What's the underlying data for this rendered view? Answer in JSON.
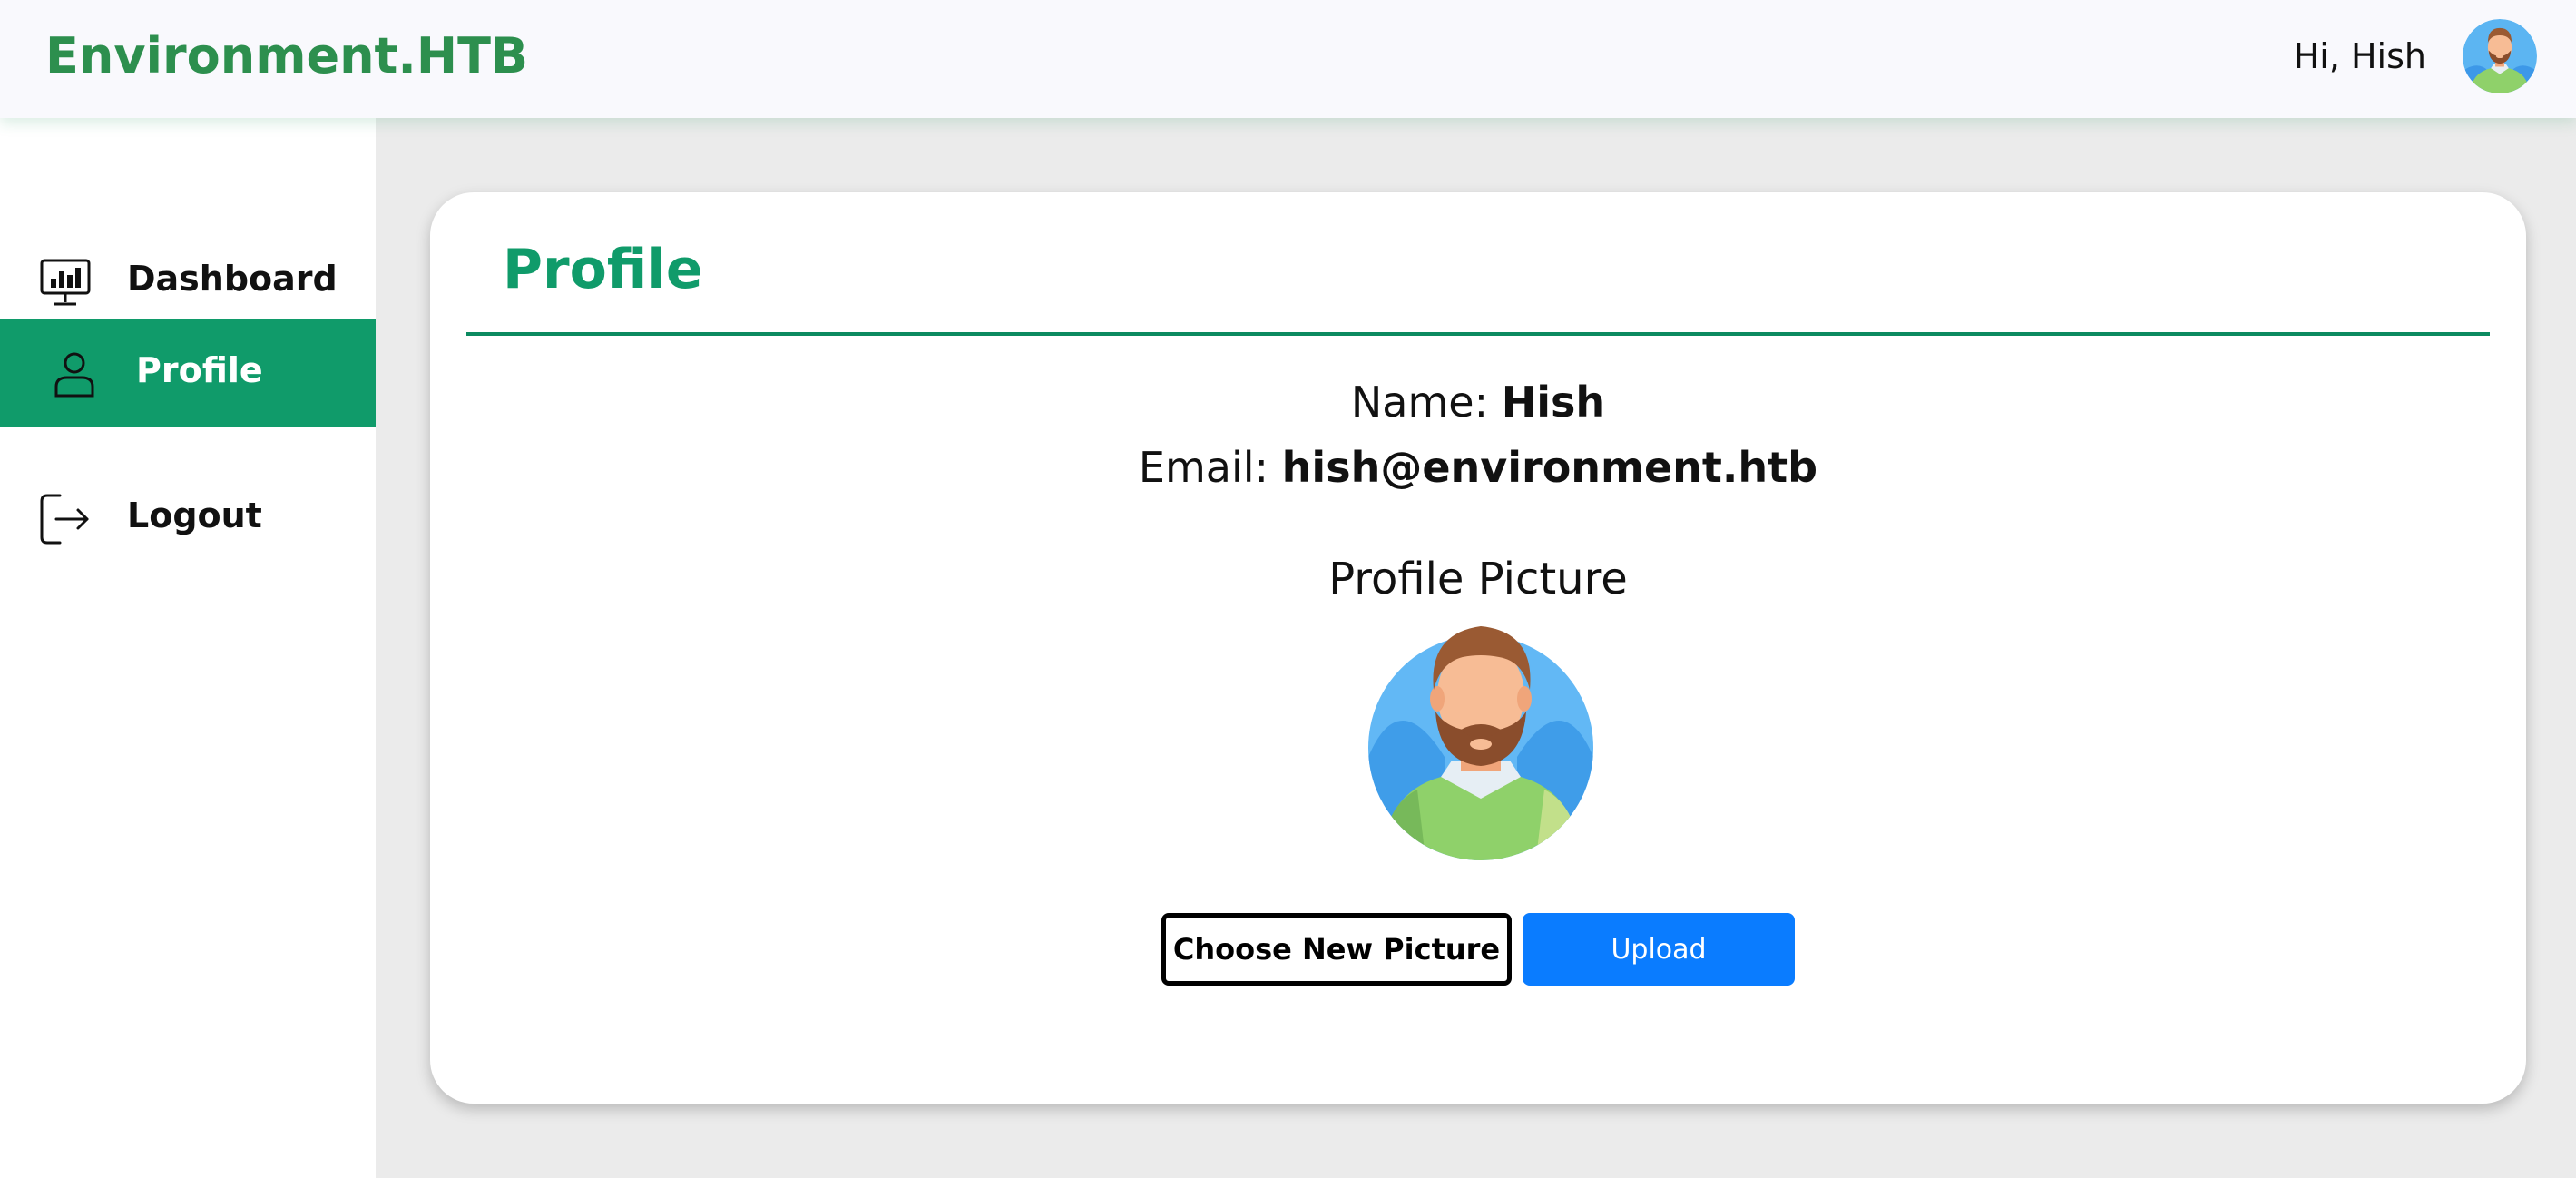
{
  "header": {
    "brand": "Environment.HTB",
    "greeting": "Hi, Hish",
    "avatar_icon": "user-avatar-icon"
  },
  "sidebar": {
    "items": [
      {
        "label": "Dashboard",
        "icon": "dashboard-monitor-icon",
        "active": false
      },
      {
        "label": "Profile",
        "icon": "user-icon",
        "active": true
      },
      {
        "label": "Logout",
        "icon": "logout-icon",
        "active": false
      }
    ]
  },
  "profile": {
    "title": "Profile",
    "name_label": "Name:",
    "name_value": "Hish",
    "email_label": "Email:",
    "email_value": "hish@environment.htb",
    "picture_heading": "Profile Picture",
    "choose_button": "Choose New Picture",
    "upload_button": "Upload"
  },
  "colors": {
    "brand": "#2d8f4e",
    "accent": "#109b6a",
    "upload_button": "#0a7cff",
    "page_background": "#ebebeb"
  }
}
